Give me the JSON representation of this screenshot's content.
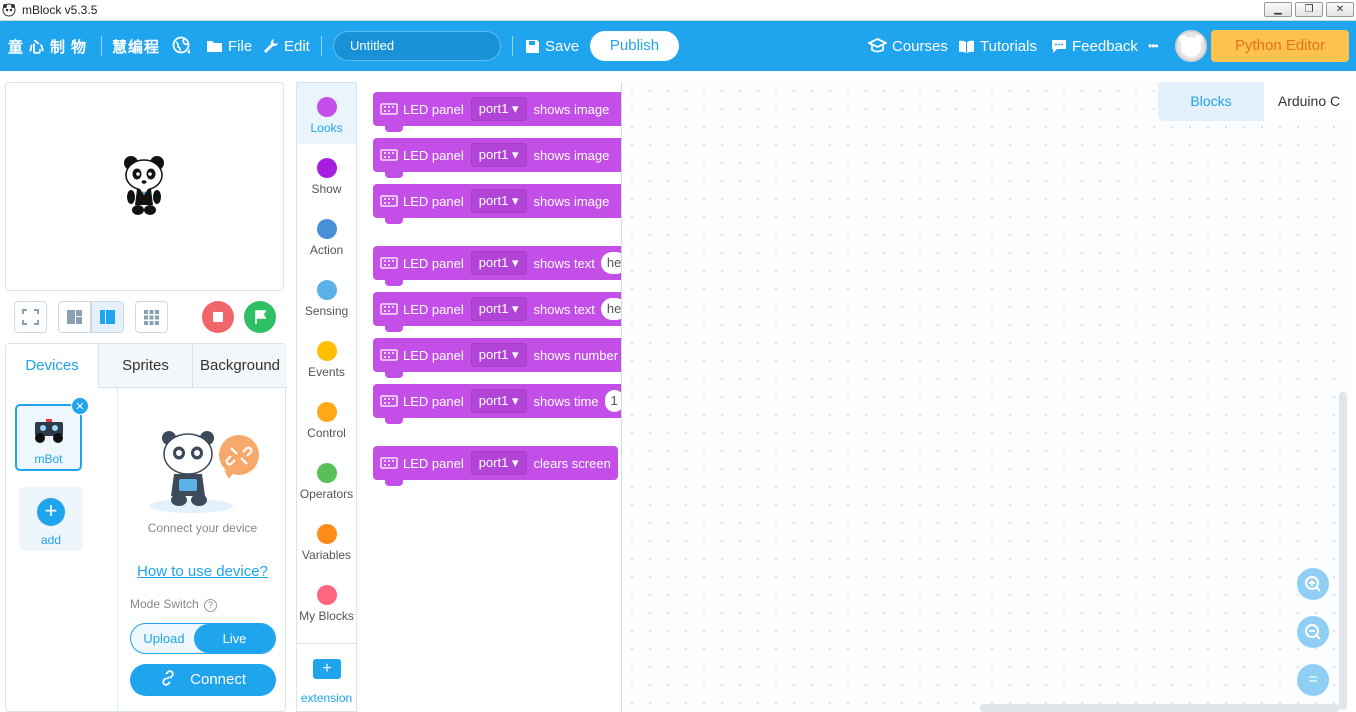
{
  "window": {
    "title": "mBlock v5.3.5",
    "controls": {
      "minimize": "▁",
      "restore": "❐",
      "close": "✕"
    }
  },
  "toolbar": {
    "brand": "童心制物",
    "brand_sub": "慧编程",
    "file_label": "File",
    "edit_label": "Edit",
    "project_name": "Untitled",
    "save_label": "Save",
    "publish_label": "Publish",
    "courses_label": "Courses",
    "tutorials_label": "Tutorials",
    "feedback_label": "Feedback",
    "more_label": "•••",
    "python_editor_label": "Python Editor"
  },
  "devices_panel": {
    "tabs": [
      "Devices",
      "Sprites",
      "Background"
    ],
    "active_tab": "Devices",
    "device_name": "mBot",
    "add_label": "add",
    "connect_prompt": "Connect your device",
    "how_to_link": "How to use device?",
    "mode_switch_label": "Mode Switch",
    "mode_upload": "Upload",
    "mode_live": "Live",
    "active_mode": "Live",
    "connect_label": "Connect"
  },
  "categories": {
    "items": [
      {
        "label": "Looks",
        "color": "#c34ee8",
        "active": true
      },
      {
        "label": "Show",
        "color": "#a51fe0",
        "active": false
      },
      {
        "label": "Action",
        "color": "#4a90d9",
        "active": false
      },
      {
        "label": "Sensing",
        "color": "#5cb1e8",
        "active": false
      },
      {
        "label": "Events",
        "color": "#ffbf00",
        "active": false
      },
      {
        "label": "Control",
        "color": "#ffab19",
        "active": false
      },
      {
        "label": "Operators",
        "color": "#59c059",
        "active": false
      },
      {
        "label": "Variables",
        "color": "#ff8c1a",
        "active": false
      },
      {
        "label": "My Blocks",
        "color": "#ff6680",
        "active": false
      }
    ],
    "extension_label": "extension"
  },
  "blocks": {
    "color": "#c34ee8",
    "items": [
      {
        "prefix": "LED panel",
        "port": "port1",
        "action": "shows image",
        "arg": ""
      },
      {
        "prefix": "LED panel",
        "port": "port1",
        "action": "shows image",
        "arg": ""
      },
      {
        "prefix": "LED panel",
        "port": "port1",
        "action": "shows image",
        "arg": ""
      },
      {
        "prefix": "LED panel",
        "port": "port1",
        "action": "shows text",
        "arg": "he"
      },
      {
        "prefix": "LED panel",
        "port": "port1",
        "action": "shows text",
        "arg": "he"
      },
      {
        "prefix": "LED panel",
        "port": "port1",
        "action": "shows number",
        "arg": ""
      },
      {
        "prefix": "LED panel",
        "port": "port1",
        "action": "shows time",
        "arg": "1"
      },
      {
        "prefix": "LED panel",
        "port": "port1",
        "action": "clears screen",
        "arg": ""
      }
    ]
  },
  "workspace": {
    "tabs": [
      "Blocks",
      "Arduino C"
    ],
    "active_tab": "Blocks",
    "zoom_in": "+",
    "zoom_out": "−",
    "zoom_reset": "="
  }
}
